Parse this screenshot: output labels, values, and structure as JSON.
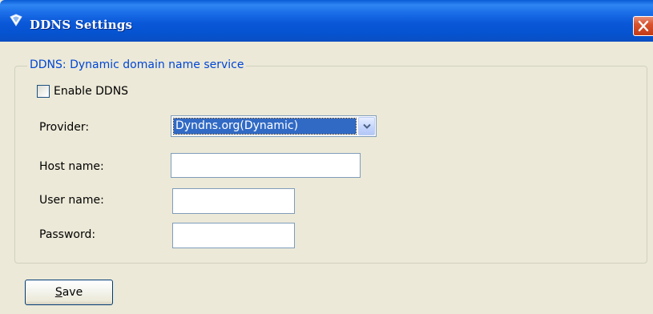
{
  "window": {
    "title": "DDNS Settings",
    "close_icon": "close-icon",
    "title_icon": "shield-icon"
  },
  "group": {
    "legend": "DDNS: Dynamic domain name service"
  },
  "enable_ddns": {
    "label": "Enable DDNS",
    "checked": false
  },
  "provider": {
    "label": "Provider:",
    "selected": "Dyndns.org(Dynamic)"
  },
  "host_name": {
    "label": "Host name:",
    "value": ""
  },
  "user_name": {
    "label": "User name:",
    "value": ""
  },
  "password": {
    "label": "Password:",
    "value": ""
  },
  "save": {
    "mnemonic": "S",
    "label_rest": "ave"
  },
  "colors": {
    "titlebar": "#0a58d8",
    "window_bg": "#ece9d8",
    "legend_text": "#0046d5",
    "close_button": "#d8532f",
    "selection": "#316ac5"
  }
}
